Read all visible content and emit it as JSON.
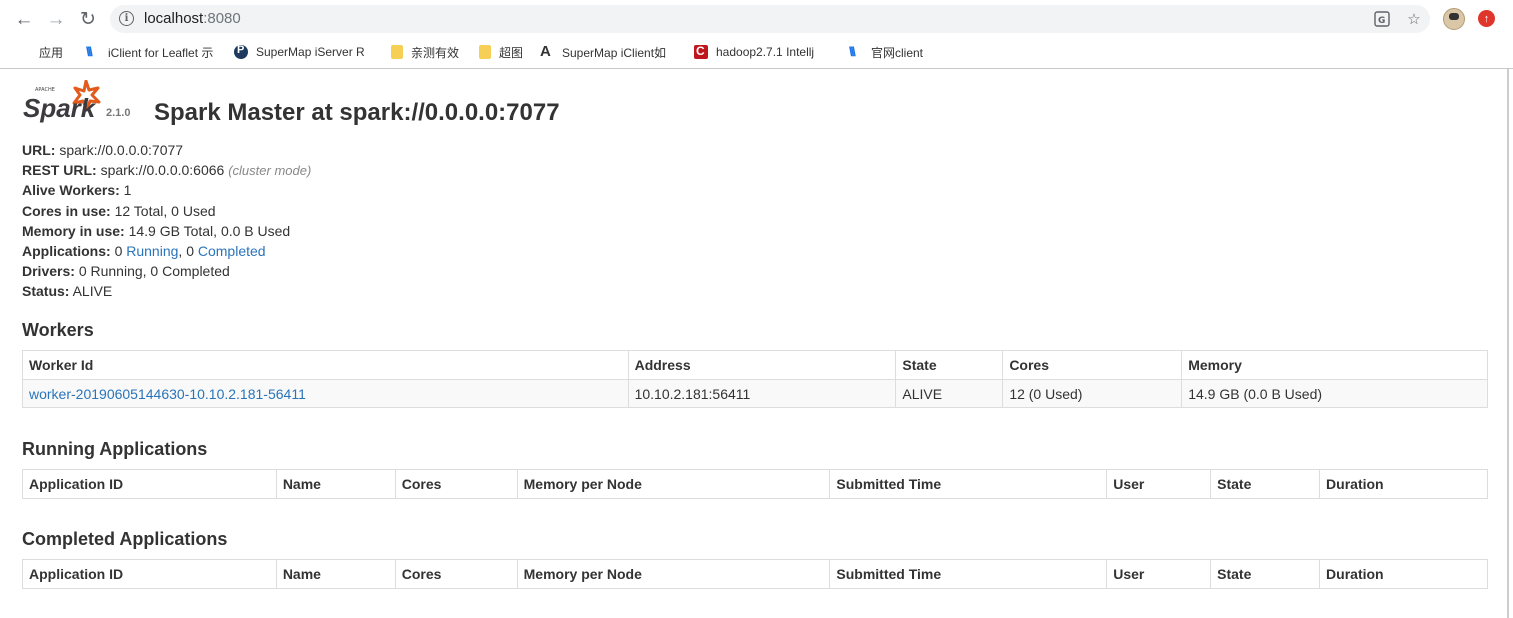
{
  "browser": {
    "url_host": "localhost",
    "url_port": ":8080",
    "icons": [
      "back-icon",
      "forward-icon",
      "reload-icon",
      "info-icon",
      "translate-icon",
      "star-icon"
    ],
    "bookmarks": [
      {
        "label": "应用",
        "icon": "apps-grid-icon"
      },
      {
        "label": "iClient for Leaflet 示",
        "icon": "iclient-icon"
      },
      {
        "label": "SuperMap iServer R",
        "icon": "supermap-icon"
      },
      {
        "label": "亲测有效",
        "icon": "folder-icon"
      },
      {
        "label": "超图",
        "icon": "folder-icon"
      },
      {
        "label": "SuperMap iClient如",
        "icon": "supermap-a-icon"
      },
      {
        "label": "hadoop2.7.1 Intellj",
        "icon": "csdn-icon"
      },
      {
        "label": "官网client",
        "icon": "iclient-icon"
      }
    ]
  },
  "header": {
    "logo_small": "APACHE",
    "logo_text": "Spark",
    "version": "2.1.0",
    "title": "Spark Master at spark://0.0.0.0:7077"
  },
  "summary": {
    "url_label": "URL:",
    "url_value": "spark://0.0.0.0:7077",
    "rest_label": "REST URL:",
    "rest_value": "spark://0.0.0.0:6066",
    "rest_mode": "(cluster mode)",
    "alive_label": "Alive Workers:",
    "alive_value": "1",
    "cores_label": "Cores in use:",
    "cores_value": "12 Total, 0 Used",
    "memory_label": "Memory in use:",
    "memory_value": "14.9 GB Total, 0.0 B Used",
    "apps_label": "Applications:",
    "apps_running_count": "0",
    "apps_running_link": "Running",
    "apps_sep": ",",
    "apps_completed_count": "0",
    "apps_completed_link": "Completed",
    "drivers_label": "Drivers:",
    "drivers_value": "0 Running, 0 Completed",
    "status_label": "Status:",
    "status_value": "ALIVE"
  },
  "workers": {
    "title": "Workers",
    "columns": [
      "Worker Id",
      "Address",
      "State",
      "Cores",
      "Memory"
    ],
    "rows": [
      {
        "id": "worker-20190605144630-10.10.2.181-56411",
        "address": "10.10.2.181:56411",
        "state": "ALIVE",
        "cores": "12 (0 Used)",
        "memory": "14.9 GB (0.0 B Used)"
      }
    ]
  },
  "running": {
    "title": "Running Applications",
    "columns": [
      "Application ID",
      "Name",
      "Cores",
      "Memory per Node",
      "Submitted Time",
      "User",
      "State",
      "Duration"
    ]
  },
  "completed": {
    "title": "Completed Applications",
    "columns": [
      "Application ID",
      "Name",
      "Cores",
      "Memory per Node",
      "Submitted Time",
      "User",
      "State",
      "Duration"
    ]
  },
  "colors": {
    "link": "#2a74ba",
    "spark_orange": "#e25a1c",
    "heading": "#333333"
  }
}
